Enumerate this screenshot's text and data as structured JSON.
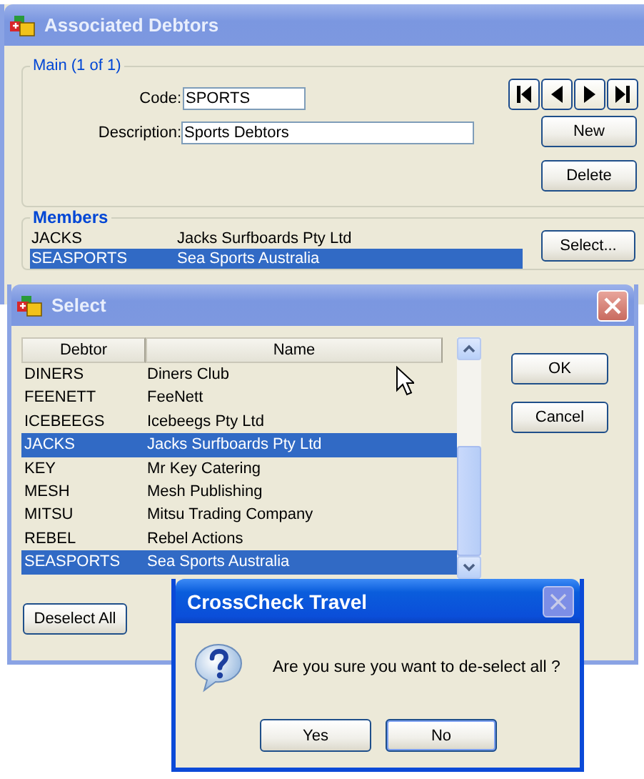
{
  "main_window": {
    "title": "Associated Debtors",
    "main_group": {
      "legend": "Main (1 of 1)",
      "code_label": "Code:",
      "code_value": "SPORTS",
      "description_label": "Description:",
      "description_value": "Sports Debtors"
    },
    "buttons": [
      "New",
      "Delete"
    ],
    "members": {
      "legend": "Members",
      "rows": [
        {
          "code": "JACKS",
          "name": "Jacks Surfboards Pty Ltd",
          "selected": false
        },
        {
          "code": "SEASPORTS",
          "name": "Sea Sports Australia",
          "selected": true
        }
      ],
      "select_button": "Select..."
    }
  },
  "select_window": {
    "title": "Select",
    "columns": [
      "Debtor",
      "Name"
    ],
    "rows": [
      {
        "debtor": "DINERS",
        "name": "Diners Club",
        "selected": false
      },
      {
        "debtor": "FEENETT",
        "name": "FeeNett",
        "selected": false
      },
      {
        "debtor": "ICEBEEGS",
        "name": "Icebeegs Pty Ltd",
        "selected": false
      },
      {
        "debtor": "JACKS",
        "name": "Jacks Surfboards Pty Ltd",
        "selected": true
      },
      {
        "debtor": "KEY",
        "name": "Mr Key Catering",
        "selected": false
      },
      {
        "debtor": "MESH",
        "name": "Mesh Publishing",
        "selected": false
      },
      {
        "debtor": "MITSU",
        "name": "Mitsu Trading Company",
        "selected": false
      },
      {
        "debtor": "REBEL",
        "name": "Rebel Actions",
        "selected": false
      },
      {
        "debtor": "SEASPORTS",
        "name": "Sea Sports Australia",
        "selected": true
      }
    ],
    "buttons": [
      "OK",
      "Cancel"
    ],
    "deselect_button": "Deselect All"
  },
  "confirm_dialog": {
    "title": "CrossCheck Travel",
    "message": "Are you sure you want to de-select all ?",
    "buttons": [
      "Yes",
      "No"
    ]
  }
}
